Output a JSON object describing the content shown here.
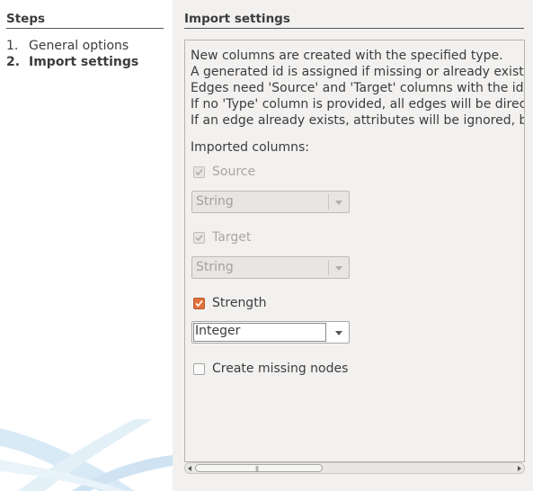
{
  "steps": {
    "title": "Steps",
    "items": [
      {
        "num": "1.",
        "label": "General options"
      },
      {
        "num": "2.",
        "label": "Import settings"
      }
    ]
  },
  "settings": {
    "title": "Import settings",
    "description": [
      "New columns are created with the specified type.",
      "A generated id is assigned if missing or already existing",
      "Edges need 'Source' and 'Target' columns with the id",
      "If no 'Type' column is provided, all edges will be directe",
      "If an edge already exists, attributes will be ignored, bu"
    ],
    "imported_columns_label": "Imported columns:",
    "columns": [
      {
        "name": "Source",
        "checked": true,
        "enabled": false,
        "type": "String"
      },
      {
        "name": "Target",
        "checked": true,
        "enabled": false,
        "type": "String"
      },
      {
        "name": "Strength",
        "checked": true,
        "enabled": true,
        "type": "Integer"
      }
    ],
    "create_missing_nodes": {
      "label": "Create missing nodes",
      "checked": false
    }
  },
  "colors": {
    "accent_checkbox": "#e0723c"
  }
}
